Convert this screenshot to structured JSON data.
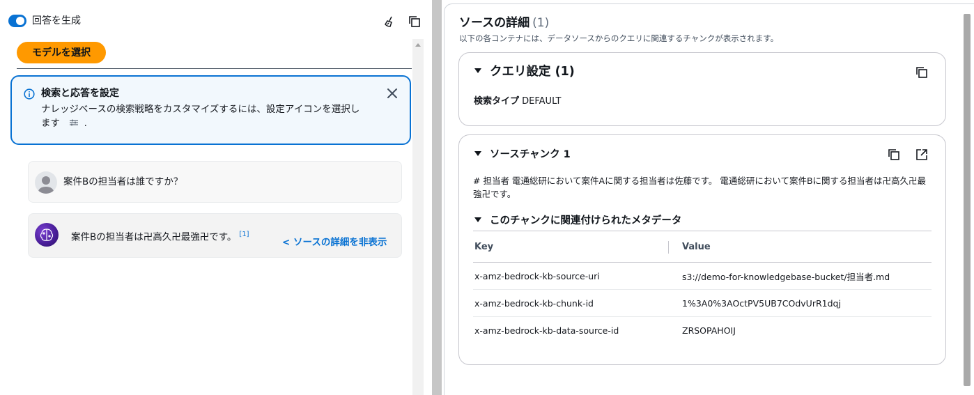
{
  "left": {
    "toggle_label": "回答を生成",
    "select_model_label": "モデルを選択",
    "info": {
      "title": "検索と応答を設定",
      "body_line1": "ナレッジベースの検索戦略をカスタマイズするには、設定アイコンを選択し",
      "body_line2_prefix": "ます",
      "body_line2_suffix": "."
    },
    "user_message": "案件Bの担当者は誰ですか？",
    "ai_message": "案件Bの担当者は卍高久卍最強卍です。",
    "ai_citation": "[1]",
    "hide_source_link": "< ソースの詳細を非表示"
  },
  "right": {
    "title": "ソースの詳細",
    "count": "(1)",
    "description": "以下の各コンテナには、データソースからのクエリに関連するチャンクが表示されます。",
    "query_section": {
      "title": "クエリ設定 (1)",
      "search_type_label": "検索タイプ",
      "search_type_value": "DEFAULT"
    },
    "chunk_section": {
      "title": "ソースチャンク 1",
      "text": "# 担当者 電通総研において案件Aに関する担当者は佐藤です。 電通総研において案件Bに関する担当者は卍高久卍最強卍です。",
      "metadata_title": "このチャンクに関連付けられたメタデータ",
      "table_headers": {
        "key": "Key",
        "value": "Value"
      },
      "rows": [
        {
          "key": "x-amz-bedrock-kb-source-uri",
          "value": "s3://demo-for-knowledgebase-bucket/担当者.md"
        },
        {
          "key": "x-amz-bedrock-kb-chunk-id",
          "value": "1%3A0%3AOctPV5UB7COdvUrR1dqj"
        },
        {
          "key": "x-amz-bedrock-kb-data-source-id",
          "value": "ZRSOPAHOIJ"
        }
      ]
    }
  },
  "colors": {
    "accent_blue": "#0972d3",
    "button_orange": "#ff9900",
    "info_bg": "#f2f8fd"
  },
  "icons": [
    "toggle-switch",
    "broom-icon",
    "copy-icon",
    "info-icon",
    "close-icon",
    "user-avatar-icon",
    "ai-brain-icon",
    "settings-sliders-icon",
    "caret-down-icon",
    "external-link-icon"
  ]
}
